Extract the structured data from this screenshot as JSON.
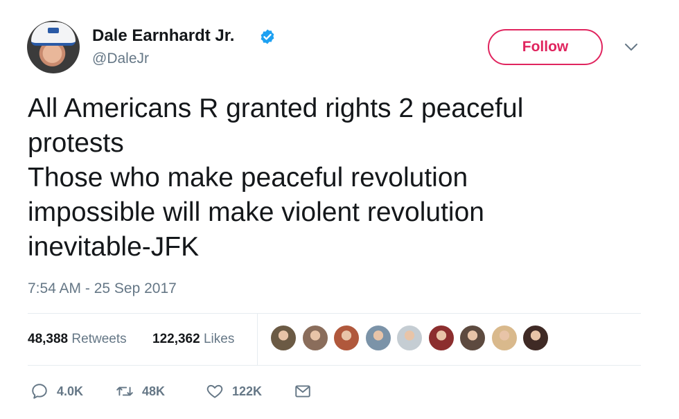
{
  "author": {
    "name": "Dale Earnhardt Jr.",
    "handle": "@DaleJr",
    "verified_icon": "verified-badge-icon"
  },
  "follow_button": {
    "label": "Follow",
    "color": "#e0245e"
  },
  "more_menu_icon": "chevron-down-icon",
  "tweet": {
    "text": "All Americans R granted rights 2 peaceful\nprotests\nThose who make peaceful revolution\nimpossible will make violent revolution\ninevitable-JFK",
    "timestamp": "7:54 AM - 25 Sep 2017"
  },
  "stats": {
    "retweets": {
      "count": "48,388",
      "label": "Retweets"
    },
    "likes": {
      "count": "122,362",
      "label": "Likes"
    },
    "liker_avatars": [
      {
        "color": "#6b5a44"
      },
      {
        "color": "#8a6d5b"
      },
      {
        "color": "#b0583c"
      },
      {
        "color": "#7b93a8"
      },
      {
        "color": "#c5cdd3"
      },
      {
        "color": "#8c2e2e"
      },
      {
        "color": "#5d4a3f"
      },
      {
        "color": "#d9b98c"
      },
      {
        "color": "#3f2a25"
      }
    ]
  },
  "actions": {
    "reply": {
      "count": "4.0K",
      "icon": "reply-icon"
    },
    "retweet": {
      "count": "48K",
      "icon": "retweet-icon"
    },
    "like": {
      "count": "122K",
      "icon": "heart-icon"
    },
    "direct_message": {
      "icon": "envelope-icon"
    }
  },
  "colors": {
    "text_primary": "#14171a",
    "text_secondary": "#657786",
    "verified_blue": "#1da1f2",
    "divider": "#e6ecf0"
  }
}
